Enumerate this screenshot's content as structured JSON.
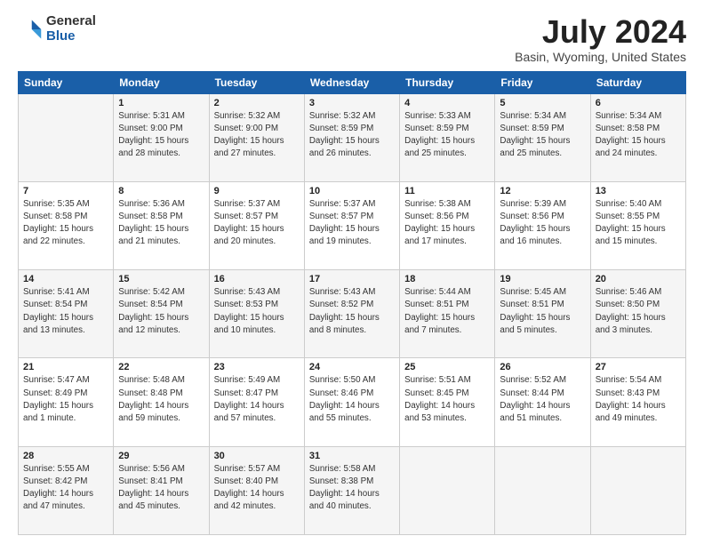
{
  "logo": {
    "general": "General",
    "blue": "Blue"
  },
  "title": "July 2024",
  "subtitle": "Basin, Wyoming, United States",
  "days_of_week": [
    "Sunday",
    "Monday",
    "Tuesday",
    "Wednesday",
    "Thursday",
    "Friday",
    "Saturday"
  ],
  "weeks": [
    [
      {
        "day": "",
        "sunrise": "",
        "sunset": "",
        "daylight": ""
      },
      {
        "day": "1",
        "sunrise": "Sunrise: 5:31 AM",
        "sunset": "Sunset: 9:00 PM",
        "daylight": "Daylight: 15 hours and 28 minutes."
      },
      {
        "day": "2",
        "sunrise": "Sunrise: 5:32 AM",
        "sunset": "Sunset: 9:00 PM",
        "daylight": "Daylight: 15 hours and 27 minutes."
      },
      {
        "day": "3",
        "sunrise": "Sunrise: 5:32 AM",
        "sunset": "Sunset: 8:59 PM",
        "daylight": "Daylight: 15 hours and 26 minutes."
      },
      {
        "day": "4",
        "sunrise": "Sunrise: 5:33 AM",
        "sunset": "Sunset: 8:59 PM",
        "daylight": "Daylight: 15 hours and 25 minutes."
      },
      {
        "day": "5",
        "sunrise": "Sunrise: 5:34 AM",
        "sunset": "Sunset: 8:59 PM",
        "daylight": "Daylight: 15 hours and 25 minutes."
      },
      {
        "day": "6",
        "sunrise": "Sunrise: 5:34 AM",
        "sunset": "Sunset: 8:58 PM",
        "daylight": "Daylight: 15 hours and 24 minutes."
      }
    ],
    [
      {
        "day": "7",
        "sunrise": "Sunrise: 5:35 AM",
        "sunset": "Sunset: 8:58 PM",
        "daylight": "Daylight: 15 hours and 22 minutes."
      },
      {
        "day": "8",
        "sunrise": "Sunrise: 5:36 AM",
        "sunset": "Sunset: 8:58 PM",
        "daylight": "Daylight: 15 hours and 21 minutes."
      },
      {
        "day": "9",
        "sunrise": "Sunrise: 5:37 AM",
        "sunset": "Sunset: 8:57 PM",
        "daylight": "Daylight: 15 hours and 20 minutes."
      },
      {
        "day": "10",
        "sunrise": "Sunrise: 5:37 AM",
        "sunset": "Sunset: 8:57 PM",
        "daylight": "Daylight: 15 hours and 19 minutes."
      },
      {
        "day": "11",
        "sunrise": "Sunrise: 5:38 AM",
        "sunset": "Sunset: 8:56 PM",
        "daylight": "Daylight: 15 hours and 17 minutes."
      },
      {
        "day": "12",
        "sunrise": "Sunrise: 5:39 AM",
        "sunset": "Sunset: 8:56 PM",
        "daylight": "Daylight: 15 hours and 16 minutes."
      },
      {
        "day": "13",
        "sunrise": "Sunrise: 5:40 AM",
        "sunset": "Sunset: 8:55 PM",
        "daylight": "Daylight: 15 hours and 15 minutes."
      }
    ],
    [
      {
        "day": "14",
        "sunrise": "Sunrise: 5:41 AM",
        "sunset": "Sunset: 8:54 PM",
        "daylight": "Daylight: 15 hours and 13 minutes."
      },
      {
        "day": "15",
        "sunrise": "Sunrise: 5:42 AM",
        "sunset": "Sunset: 8:54 PM",
        "daylight": "Daylight: 15 hours and 12 minutes."
      },
      {
        "day": "16",
        "sunrise": "Sunrise: 5:43 AM",
        "sunset": "Sunset: 8:53 PM",
        "daylight": "Daylight: 15 hours and 10 minutes."
      },
      {
        "day": "17",
        "sunrise": "Sunrise: 5:43 AM",
        "sunset": "Sunset: 8:52 PM",
        "daylight": "Daylight: 15 hours and 8 minutes."
      },
      {
        "day": "18",
        "sunrise": "Sunrise: 5:44 AM",
        "sunset": "Sunset: 8:51 PM",
        "daylight": "Daylight: 15 hours and 7 minutes."
      },
      {
        "day": "19",
        "sunrise": "Sunrise: 5:45 AM",
        "sunset": "Sunset: 8:51 PM",
        "daylight": "Daylight: 15 hours and 5 minutes."
      },
      {
        "day": "20",
        "sunrise": "Sunrise: 5:46 AM",
        "sunset": "Sunset: 8:50 PM",
        "daylight": "Daylight: 15 hours and 3 minutes."
      }
    ],
    [
      {
        "day": "21",
        "sunrise": "Sunrise: 5:47 AM",
        "sunset": "Sunset: 8:49 PM",
        "daylight": "Daylight: 15 hours and 1 minute."
      },
      {
        "day": "22",
        "sunrise": "Sunrise: 5:48 AM",
        "sunset": "Sunset: 8:48 PM",
        "daylight": "Daylight: 14 hours and 59 minutes."
      },
      {
        "day": "23",
        "sunrise": "Sunrise: 5:49 AM",
        "sunset": "Sunset: 8:47 PM",
        "daylight": "Daylight: 14 hours and 57 minutes."
      },
      {
        "day": "24",
        "sunrise": "Sunrise: 5:50 AM",
        "sunset": "Sunset: 8:46 PM",
        "daylight": "Daylight: 14 hours and 55 minutes."
      },
      {
        "day": "25",
        "sunrise": "Sunrise: 5:51 AM",
        "sunset": "Sunset: 8:45 PM",
        "daylight": "Daylight: 14 hours and 53 minutes."
      },
      {
        "day": "26",
        "sunrise": "Sunrise: 5:52 AM",
        "sunset": "Sunset: 8:44 PM",
        "daylight": "Daylight: 14 hours and 51 minutes."
      },
      {
        "day": "27",
        "sunrise": "Sunrise: 5:54 AM",
        "sunset": "Sunset: 8:43 PM",
        "daylight": "Daylight: 14 hours and 49 minutes."
      }
    ],
    [
      {
        "day": "28",
        "sunrise": "Sunrise: 5:55 AM",
        "sunset": "Sunset: 8:42 PM",
        "daylight": "Daylight: 14 hours and 47 minutes."
      },
      {
        "day": "29",
        "sunrise": "Sunrise: 5:56 AM",
        "sunset": "Sunset: 8:41 PM",
        "daylight": "Daylight: 14 hours and 45 minutes."
      },
      {
        "day": "30",
        "sunrise": "Sunrise: 5:57 AM",
        "sunset": "Sunset: 8:40 PM",
        "daylight": "Daylight: 14 hours and 42 minutes."
      },
      {
        "day": "31",
        "sunrise": "Sunrise: 5:58 AM",
        "sunset": "Sunset: 8:38 PM",
        "daylight": "Daylight: 14 hours and 40 minutes."
      },
      {
        "day": "",
        "sunrise": "",
        "sunset": "",
        "daylight": ""
      },
      {
        "day": "",
        "sunrise": "",
        "sunset": "",
        "daylight": ""
      },
      {
        "day": "",
        "sunrise": "",
        "sunset": "",
        "daylight": ""
      }
    ]
  ]
}
